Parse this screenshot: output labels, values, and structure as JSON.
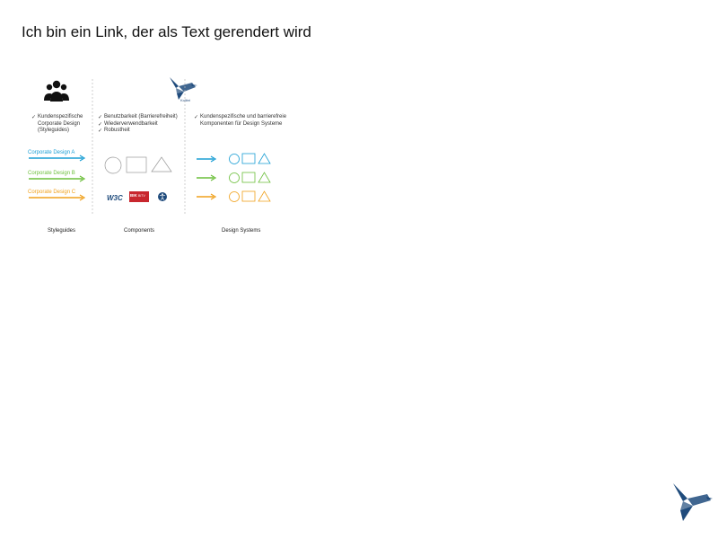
{
  "link_text": "Ich bin ein Link, der als Text gerendert wird",
  "brand": {
    "name": "Kolibri",
    "color": "#1f4b7c"
  },
  "columns": [
    {
      "label": "Styleguides",
      "checks": [
        "Kundenspezifische",
        "Corporate Design",
        "(Styleguides)"
      ]
    },
    {
      "label": "Components",
      "checks": [
        "Benutzbarkeit (Barrierefreiheit)",
        "Wiederverwendbarkeit",
        "Robustheit"
      ]
    },
    {
      "label": "Design Systems",
      "checks": [
        "Kundenspezifische und barrierefreie",
        "Komponenten für Design Systeme"
      ]
    }
  ],
  "rows": [
    {
      "label": "Corporate Design A",
      "color": "#1a9ed4"
    },
    {
      "label": "Corporate Design B",
      "color": "#6cbf3b"
    },
    {
      "label": "Corporate Design C",
      "color": "#f0a11c"
    }
  ],
  "logos": {
    "w3c": "W3C",
    "bitv": "BITV",
    "bik": "BIK",
    "accessibility_icon": "accessibility-icon"
  },
  "icons": [
    "people-icon",
    "kolibri-logo",
    "check-icon",
    "circle-icon",
    "square-icon",
    "triangle-icon",
    "arrow-right-icon"
  ]
}
